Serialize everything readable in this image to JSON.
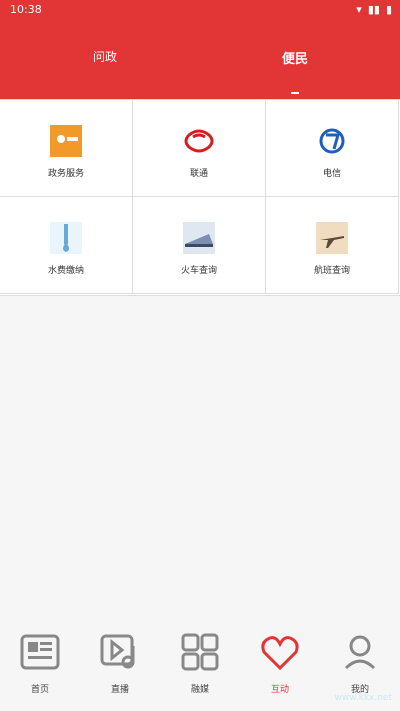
{
  "status": {
    "time": "10:38"
  },
  "tabs": {
    "left": "问政",
    "right": "便民"
  },
  "grid": [
    {
      "label": "政务服务",
      "icon_color": "#f19a2a"
    },
    {
      "label": "联通",
      "icon_color": "#d61d1d"
    },
    {
      "label": "电信",
      "icon_color": "#1d5fbf"
    },
    {
      "label": "水费缴纳",
      "icon_color": "#6aa8d6"
    },
    {
      "label": "火车查询",
      "icon_color": "#7a8fb3"
    },
    {
      "label": "航班查询",
      "icon_color": "#c8a06a"
    }
  ],
  "nav": [
    {
      "label": "首页"
    },
    {
      "label": "直播"
    },
    {
      "label": "融媒"
    },
    {
      "label": "互动"
    },
    {
      "label": "我的"
    }
  ],
  "watermark": "www.kkx.net"
}
